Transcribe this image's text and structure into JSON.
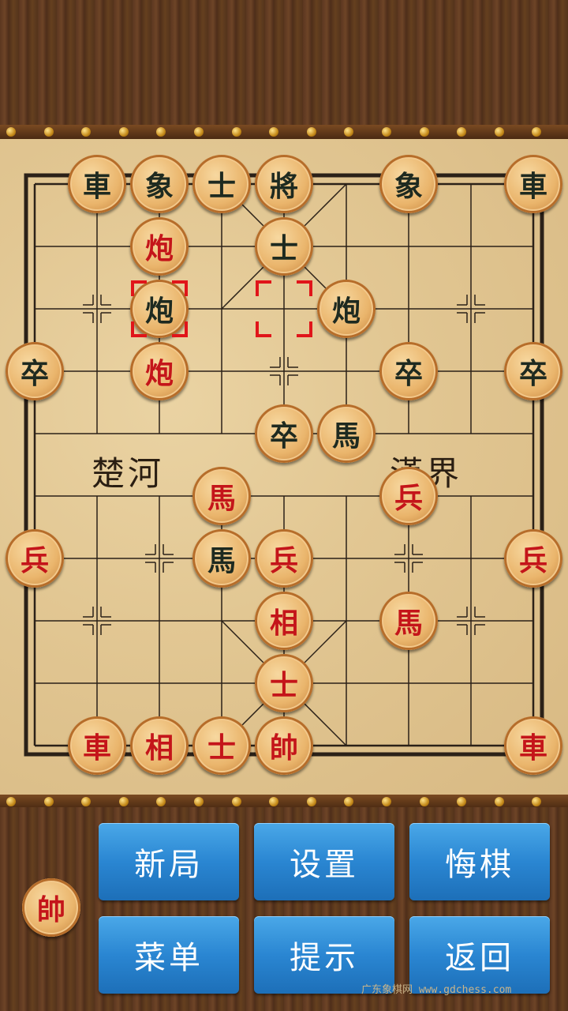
{
  "board": {
    "river_left": "楚河",
    "river_right": "漢界",
    "pieces": [
      {
        "side": "black",
        "char": "車",
        "file": 1,
        "rank": 0
      },
      {
        "side": "black",
        "char": "象",
        "file": 2,
        "rank": 0
      },
      {
        "side": "black",
        "char": "士",
        "file": 3,
        "rank": 0
      },
      {
        "side": "black",
        "char": "將",
        "file": 4,
        "rank": 0
      },
      {
        "side": "black",
        "char": "象",
        "file": 6,
        "rank": 0
      },
      {
        "side": "black",
        "char": "車",
        "file": 8,
        "rank": 0
      },
      {
        "side": "red",
        "char": "炮",
        "file": 2,
        "rank": 1
      },
      {
        "side": "black",
        "char": "士",
        "file": 4,
        "rank": 1
      },
      {
        "side": "black",
        "char": "炮",
        "file": 2,
        "rank": 2
      },
      {
        "side": "black",
        "char": "炮",
        "file": 5,
        "rank": 2
      },
      {
        "side": "black",
        "char": "卒",
        "file": 0,
        "rank": 3
      },
      {
        "side": "red",
        "char": "炮",
        "file": 2,
        "rank": 3
      },
      {
        "side": "black",
        "char": "卒",
        "file": 6,
        "rank": 3
      },
      {
        "side": "black",
        "char": "卒",
        "file": 8,
        "rank": 3
      },
      {
        "side": "black",
        "char": "卒",
        "file": 4,
        "rank": 4
      },
      {
        "side": "black",
        "char": "馬",
        "file": 5,
        "rank": 4
      },
      {
        "side": "red",
        "char": "馬",
        "file": 3,
        "rank": 5
      },
      {
        "side": "red",
        "char": "兵",
        "file": 6,
        "rank": 5
      },
      {
        "side": "red",
        "char": "兵",
        "file": 0,
        "rank": 6
      },
      {
        "side": "black",
        "char": "馬",
        "file": 3,
        "rank": 6
      },
      {
        "side": "red",
        "char": "兵",
        "file": 4,
        "rank": 6
      },
      {
        "side": "red",
        "char": "兵",
        "file": 8,
        "rank": 6
      },
      {
        "side": "red",
        "char": "相",
        "file": 4,
        "rank": 7
      },
      {
        "side": "red",
        "char": "馬",
        "file": 6,
        "rank": 7
      },
      {
        "side": "red",
        "char": "士",
        "file": 4,
        "rank": 8
      },
      {
        "side": "red",
        "char": "車",
        "file": 1,
        "rank": 9
      },
      {
        "side": "red",
        "char": "相",
        "file": 2,
        "rank": 9
      },
      {
        "side": "red",
        "char": "士",
        "file": 3,
        "rank": 9
      },
      {
        "side": "red",
        "char": "帥",
        "file": 4,
        "rank": 9
      },
      {
        "side": "red",
        "char": "車",
        "file": 8,
        "rank": 9
      }
    ],
    "last_move": [
      {
        "file": 2,
        "rank": 2
      },
      {
        "file": 4,
        "rank": 2
      }
    ]
  },
  "turn_indicator": {
    "side": "red",
    "char": "帥"
  },
  "buttons": {
    "new_game": "新局",
    "settings": "设置",
    "undo": "悔棋",
    "menu": "菜单",
    "hint": "提示",
    "back": "返回"
  },
  "watermark": "广东象棋网 www.gdchess.com"
}
